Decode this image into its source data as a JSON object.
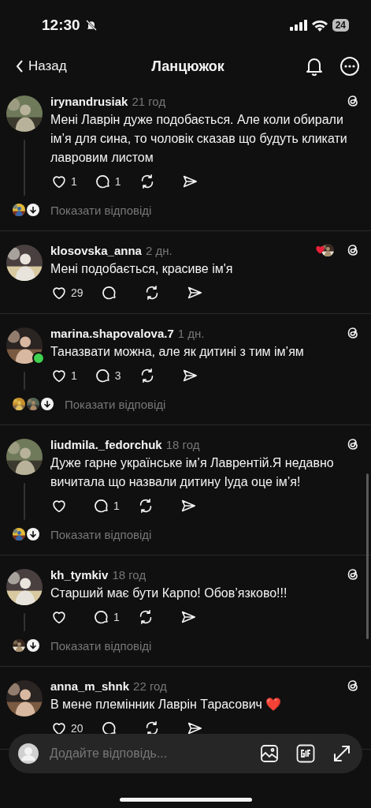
{
  "status_bar": {
    "time": "12:30",
    "battery": "24"
  },
  "nav": {
    "back": "Назад",
    "title": "Ланцюжок"
  },
  "posts": [
    {
      "username": "irynandrusiak",
      "time": "21 год",
      "text": "Мені Лаврін дуже подобається. Але коли обирали ім’я для сина, то чоловік сказав що будуть кликати лавровим листом",
      "likes": "1",
      "replies": "1",
      "online": false,
      "author_liked": false,
      "show_replies": {
        "label": "Показати відповіді"
      }
    },
    {
      "username": "klosovska_anna",
      "time": "2 дн.",
      "text": "Мені подобається, красиве ім'я",
      "likes": "29",
      "online": false,
      "author_liked": true
    },
    {
      "username": "marina.shapovalova.7",
      "time": "1 дн.",
      "text": "Таназвати можна, але як дитині з тим ім’ям",
      "likes": "1",
      "replies": "3",
      "online": true,
      "author_liked": false,
      "show_replies": {
        "label": "Показати відповіді"
      }
    },
    {
      "username": "liudmila._fedorchuk",
      "time": "18 год",
      "text": "Дуже гарне українське ім’я Лаврентій.Я недавно вичитала що назвали дитину Іуда оце ім’я!",
      "replies": "1",
      "online": false,
      "author_liked": false,
      "show_replies": {
        "label": "Показати відповіді"
      }
    },
    {
      "username": "kh_tymkiv",
      "time": "18 год",
      "text": "Старший має бути Карпо! Обов’язково!!!",
      "replies": "1",
      "online": false,
      "author_liked": false,
      "show_replies": {
        "label": "Показати відповіді"
      }
    },
    {
      "username": "anna_m_shnk",
      "time": "22 год",
      "text": "В мене племінник Лаврін Тарасович ❤️",
      "likes": "20",
      "online": false,
      "author_liked": false
    }
  ],
  "composer": {
    "placeholder": "Додайте відповідь..."
  }
}
